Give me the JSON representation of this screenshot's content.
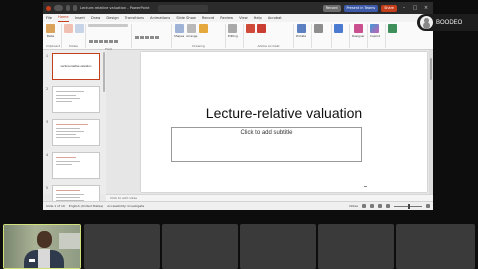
{
  "app": {
    "window_title": "Lecture-relative valuation - PowerPoint",
    "search_placeholder": "Search",
    "record_label": "Record",
    "present_label": "Present in Teams",
    "share_label": "Share"
  },
  "menu": [
    "File",
    "Home",
    "Insert",
    "Draw",
    "Design",
    "Transitions",
    "Animations",
    "Slide Show",
    "Record",
    "Review",
    "View",
    "Help",
    "Acrobat"
  ],
  "menu_active": "Home",
  "ribbon": {
    "groups": [
      {
        "label": "Clipboard",
        "buttons": [
          "Paste"
        ]
      },
      {
        "label": "Slides",
        "buttons": [
          "New Slide",
          "Reuse Slides"
        ]
      },
      {
        "label": "Font",
        "buttons": []
      },
      {
        "label": "Paragraph",
        "buttons": []
      },
      {
        "label": "Drawing",
        "buttons": [
          "Shapes",
          "Arrange",
          "Quick Styles"
        ]
      },
      {
        "label": "Editing",
        "buttons": [
          "Editing"
        ]
      },
      {
        "label": "Adobe Acrobat",
        "buttons": [
          "Create PDF and Share link",
          "Create PDF and Share via Outlook"
        ]
      },
      {
        "label": "Voice",
        "buttons": [
          "Dictate"
        ]
      },
      {
        "label": "Sensitivity",
        "buttons": [
          "Sensitivity"
        ]
      },
      {
        "label": "Add-ins",
        "buttons": [
          "Add-ins"
        ]
      },
      {
        "label": "Designer",
        "buttons": [
          "Designer"
        ]
      },
      {
        "label": "Copilot",
        "buttons": [
          "Copilot"
        ]
      },
      {
        "label": "Analyze",
        "buttons": [
          "Analyze"
        ]
      }
    ]
  },
  "thumbnails": [
    {
      "num": "1",
      "title": "Lecture-relative valuation",
      "selected": true
    },
    {
      "num": "2",
      "title": "",
      "selected": false
    },
    {
      "num": "3",
      "title": "",
      "selected": false
    },
    {
      "num": "4",
      "title": "",
      "selected": false
    },
    {
      "num": "5",
      "title": "",
      "selected": false
    }
  ],
  "slide": {
    "title": "Lecture-relative valuation",
    "subtitle_placeholder": "Click to add subtitle"
  },
  "notes_placeholder": "Click to add notes",
  "status": {
    "slide_info": "Slide 1 of 19",
    "language": "English (United States)",
    "accessibility": "Accessibility: Investigate",
    "zoom": "Notes"
  },
  "participant": {
    "name": "BOODEO"
  },
  "colors": {
    "accent": "#c43e1c",
    "record": "#6b6b6b",
    "present": "#3d5aa8",
    "share": "#c43e1c",
    "speaker_border": "#cfe07a"
  }
}
